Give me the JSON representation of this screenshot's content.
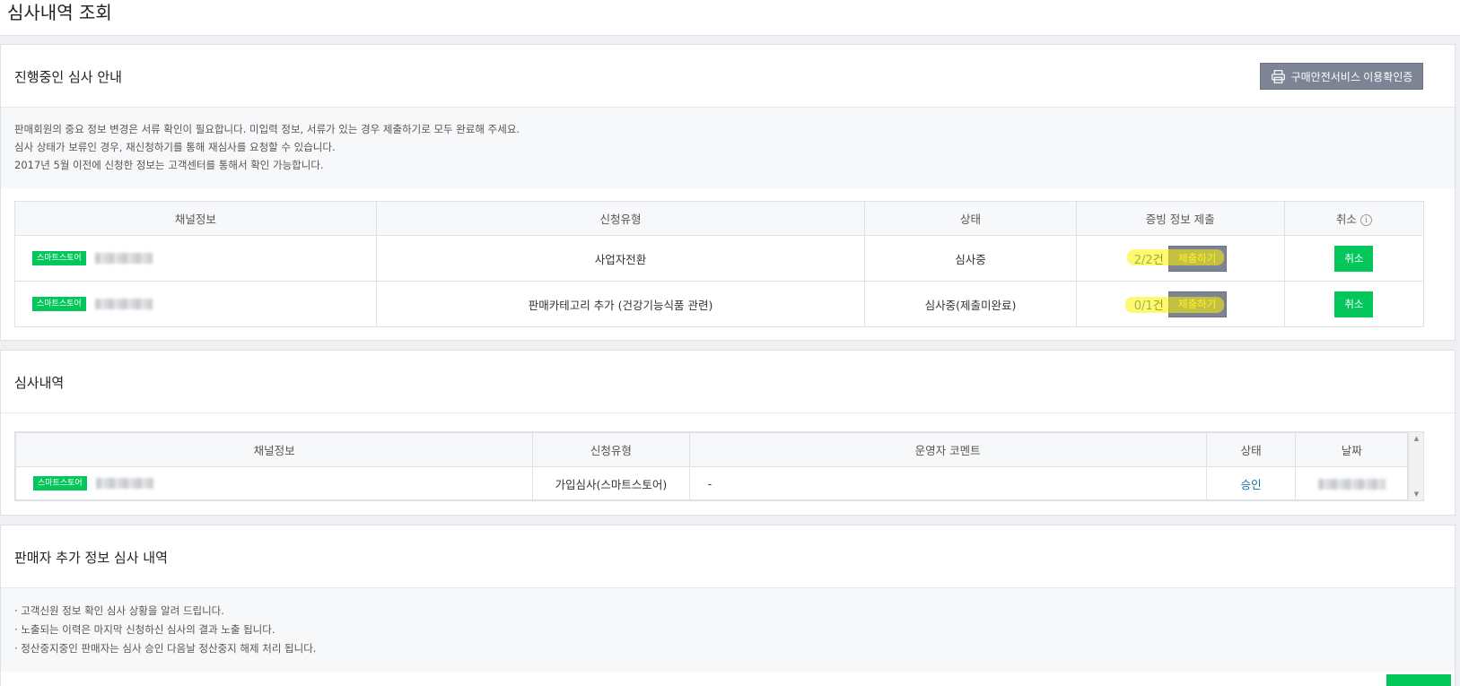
{
  "page": {
    "title": "심사내역 조회"
  },
  "ongoing": {
    "title": "진행중인 심사 안내",
    "print_button": "구매안전서비스 이용확인증",
    "notice": [
      "판매회원의 중요 정보 변경은 서류 확인이 필요합니다. 미입력 정보, 서류가 있는 경우 제출하기로 모두 완료해 주세요.",
      "심사 상태가 보류인 경우, 재신청하기를 통해 재심사를 요청할 수 있습니다.",
      "2017년 5월 이전에 신청한 정보는 고객센터를 통해서 확인 가능합니다."
    ],
    "columns": [
      "채널정보",
      "신청유형",
      "상태",
      "증빙 정보 제출",
      "취소"
    ],
    "rows": [
      {
        "badge": "스마트스토어",
        "type": "사업자전환",
        "status": "심사중",
        "evidence_count": "2/2",
        "evidence_unit": "건",
        "submit": "제출하기",
        "cancel": "취소"
      },
      {
        "badge": "스마트스토어",
        "type": "판매카테고리 추가 (건강기능식품 관련)",
        "status": "심사중(제출미완료)",
        "evidence_count": "0/1",
        "evidence_unit": "건",
        "submit": "제출하기",
        "cancel": "취소"
      }
    ]
  },
  "history": {
    "title": "심사내역",
    "columns": [
      "채널정보",
      "신청유형",
      "운영자 코멘트",
      "상태",
      "날짜"
    ],
    "rows": [
      {
        "badge": "스마트스토어",
        "type": "가입심사(스마트스토어)",
        "comment": "-",
        "status": "승인"
      }
    ]
  },
  "seller_extra": {
    "title": "판매자 추가 정보 심사 내역",
    "bullets": [
      "· 고객신원 정보 확인 심사 상황을 알려 드립니다.",
      "· 노출되는 이력은 마지막 신청하신 심사의 결과 노출 됩니다.",
      "· 정산중지중인 판매자는 심사 승인 다음날 정산중지 해제 처리 됩니다."
    ]
  }
}
